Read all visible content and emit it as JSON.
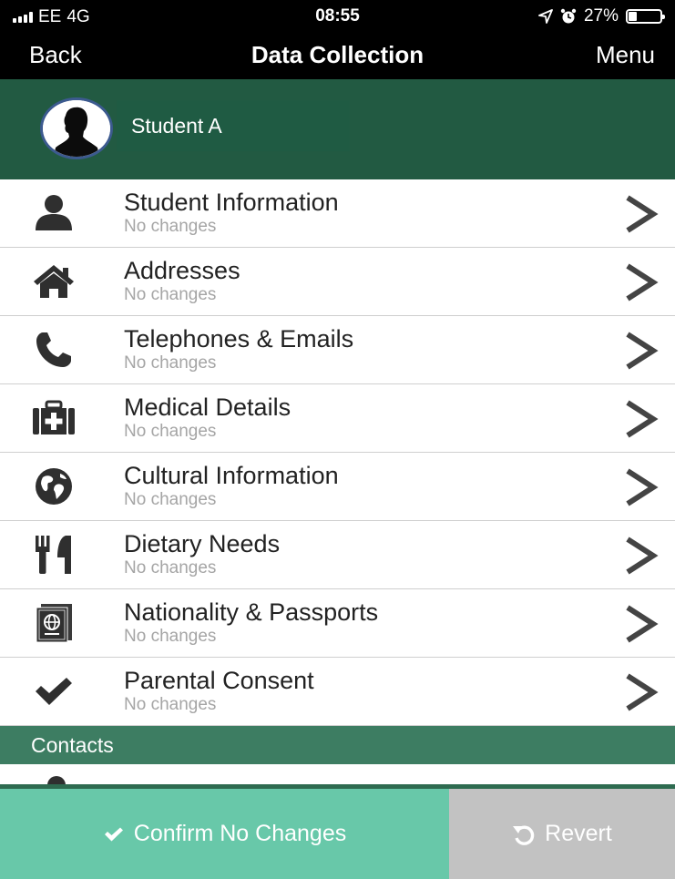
{
  "status_bar": {
    "carrier": "EE",
    "network": "4G",
    "time": "08:55",
    "battery_percent": "27%",
    "battery_level": 0.27,
    "icons": [
      "signal-icon",
      "location-arrow-icon",
      "alarm-icon",
      "battery-icon"
    ]
  },
  "nav": {
    "back_label": "Back",
    "title": "Data Collection",
    "menu_label": "Menu"
  },
  "student": {
    "name": "Student A",
    "avatar_icon": "person-silhouette-icon"
  },
  "sections": [
    {
      "title": "Student Information",
      "subtitle": "No changes",
      "icon": "user-icon"
    },
    {
      "title": "Addresses",
      "subtitle": "No changes",
      "icon": "home-icon"
    },
    {
      "title": "Telephones & Emails",
      "subtitle": "No changes",
      "icon": "phone-icon"
    },
    {
      "title": "Medical Details",
      "subtitle": "No changes",
      "icon": "medical-kit-icon"
    },
    {
      "title": "Cultural Information",
      "subtitle": "No changes",
      "icon": "globe-icon"
    },
    {
      "title": "Dietary Needs",
      "subtitle": "No changes",
      "icon": "cutlery-icon"
    },
    {
      "title": "Nationality & Passports",
      "subtitle": "No changes",
      "icon": "passport-icon"
    },
    {
      "title": "Parental Consent",
      "subtitle": "No changes",
      "icon": "checkmark-icon"
    }
  ],
  "contacts": {
    "header": "Contacts"
  },
  "actions": {
    "confirm_label": "Confirm No Changes",
    "revert_label": "Revert"
  },
  "colors": {
    "header_green": "#225a42",
    "contacts_green": "#3d7d62",
    "confirm_green": "#68c8a9",
    "revert_grey": "#c2c2c2",
    "icon_dark": "#2f2f2f"
  }
}
